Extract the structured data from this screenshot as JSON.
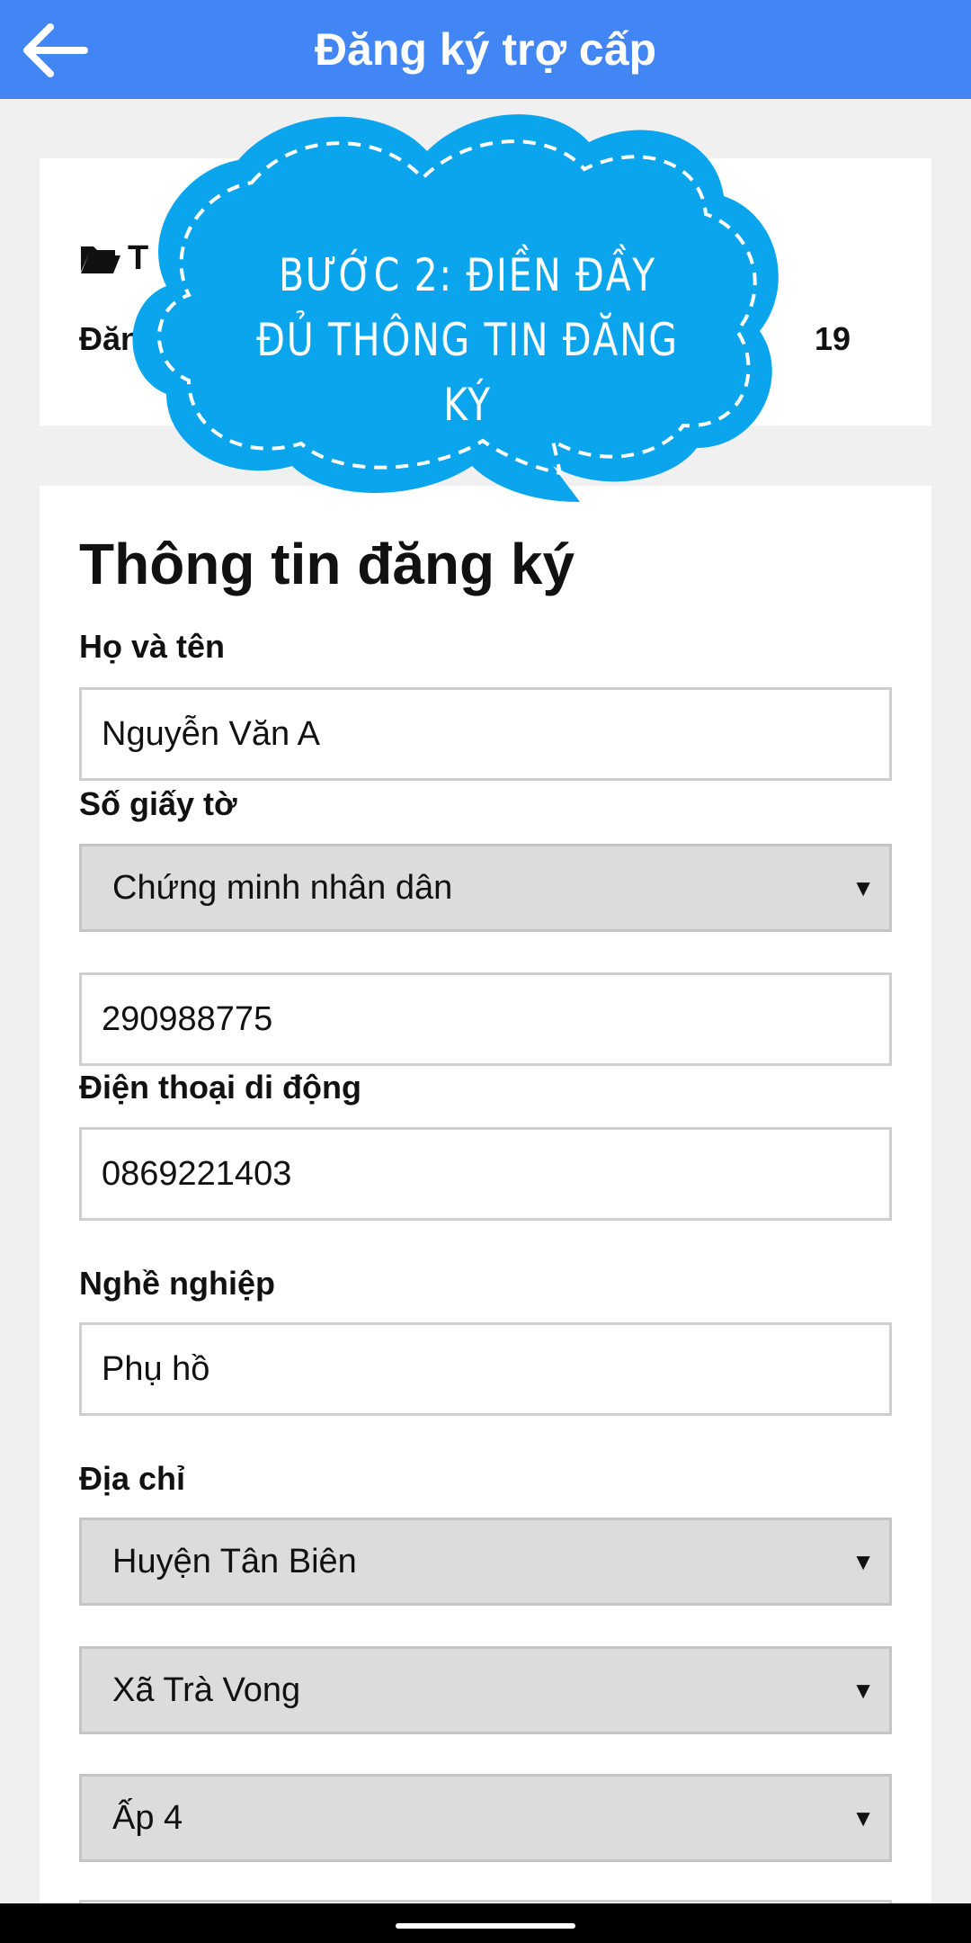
{
  "header": {
    "title": "Đăng ký trợ cấp",
    "back_icon": "arrow-left-icon"
  },
  "summary_card": {
    "row1_visible": "T",
    "row2_start": "Đăng",
    "row2_end": "19"
  },
  "overlay": {
    "line1": "BƯỚC 2: ĐIỀN ĐẦY",
    "line2": "ĐỦ THÔNG TIN ĐĂNG KÝ",
    "color": "#0aa5ec"
  },
  "form": {
    "title": "Thông tin đăng ký",
    "name_label": "Họ và tên",
    "name_value": "Nguyễn Văn A",
    "doc_label": "Số giấy tờ",
    "doc_type": "Chứng minh nhân dân",
    "doc_number": "290988775",
    "phone_label": "Điện thoại di động",
    "phone_value": "0869221403",
    "job_label": "Nghề nghiệp",
    "job_value": "Phụ hồ",
    "address_label": "Địa chỉ",
    "district": "Huyện Tân Biên",
    "commune": "Xã Trà Vong",
    "hamlet": "Ấp 4"
  },
  "colors": {
    "appbar": "#4285f4",
    "select_bg": "#dcdcdc",
    "page_bg": "#f0f0f0"
  }
}
